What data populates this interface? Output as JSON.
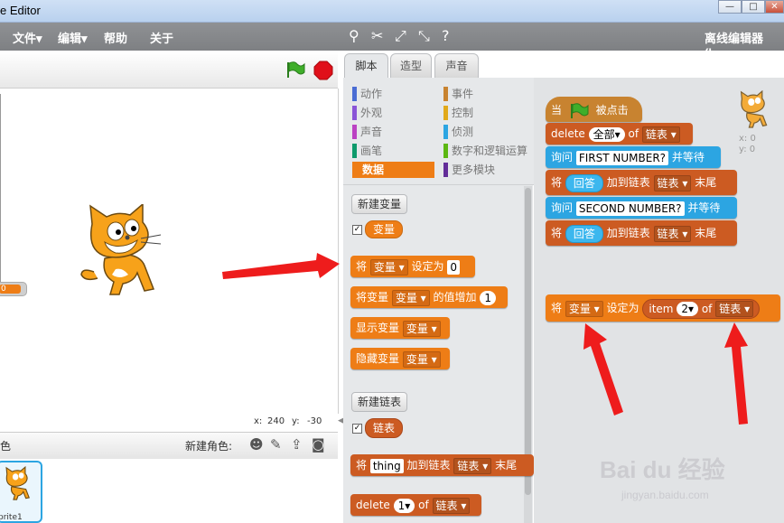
{
  "window": {
    "title": "e Editor",
    "buttons": [
      "—",
      "□",
      "✕"
    ]
  },
  "menubar": {
    "file": "文件",
    "edit": "编辑",
    "help": "帮助",
    "about": "关于",
    "right_label": "离线编辑器 (be"
  },
  "stage": {
    "coords": {
      "x_label": "x:",
      "x_value": "240",
      "y_label": "y:",
      "y_value": "-30"
    },
    "monitor_value": "0",
    "sprites_label": "色",
    "new_sprite_label": "新建角色:",
    "sprite_name": "prite1"
  },
  "tabs": [
    {
      "label": "脚本"
    },
    {
      "label": "造型"
    },
    {
      "label": "声音"
    }
  ],
  "categories": [
    {
      "label": "动作",
      "color": "#4a6cd4"
    },
    {
      "label": "事件",
      "color": "#c88330"
    },
    {
      "label": "外观",
      "color": "#8a55d7"
    },
    {
      "label": "控制",
      "color": "#e1a91a"
    },
    {
      "label": "声音",
      "color": "#bb42c3"
    },
    {
      "label": "侦测",
      "color": "#2ca5e2"
    },
    {
      "label": "画笔",
      "color": "#0e9a6c"
    },
    {
      "label": "数字和逻辑运算",
      "color": "#5cb712"
    },
    {
      "label": "数据",
      "color": "#ee7d16"
    },
    {
      "label": "更多模块",
      "color": "#632d99"
    }
  ],
  "palette": {
    "new_variable": "新建变量",
    "variable_reporter": "变量",
    "set_block": {
      "prefix": "将",
      "var": "变量",
      "middle": "设定为",
      "value": "0"
    },
    "change_block": {
      "prefix": "将变量",
      "var": "变量",
      "middle": "的值增加",
      "value": "1"
    },
    "show_block": {
      "prefix": "显示变量",
      "var": "变量"
    },
    "hide_block": {
      "prefix": "隐藏变量",
      "var": "变量"
    },
    "new_list": "新建链表",
    "list_reporter": "链表",
    "add_block": {
      "prefix": "将",
      "value": "thing",
      "middle": "加到链表",
      "list": "链表",
      "suffix": "末尾"
    },
    "delete_block": {
      "prefix": "delete",
      "value": "1",
      "middle": "of",
      "list": "链表"
    }
  },
  "script": {
    "hat": {
      "prefix": "当",
      "suffix": "被点击"
    },
    "delete_block": {
      "prefix": "delete",
      "value": "全部",
      "middle": "of",
      "list": "链表"
    },
    "ask1": {
      "prefix": "询问",
      "question": "FIRST NUMBER?",
      "suffix": "并等待"
    },
    "add1": {
      "prefix": "将",
      "answer": "回答",
      "middle": "加到链表",
      "list": "链表",
      "suffix": "末尾"
    },
    "ask2": {
      "prefix": "询问",
      "question": "SECOND NUMBER?",
      "suffix": "并等待"
    },
    "add2": {
      "prefix": "将",
      "answer": "回答",
      "middle": "加到链表",
      "list": "链表",
      "suffix": "末尾"
    },
    "set_block": {
      "prefix": "将",
      "var": "变量",
      "middle": "设定为",
      "item_label": "item",
      "item_value": "2",
      "of": "of",
      "list": "链表"
    },
    "sprite_x": "x: 0",
    "sprite_y": "y: 0"
  },
  "watermark": {
    "brand": "Bai du 经验",
    "url": "jingyan.baidu.com"
  },
  "colors": {
    "data_orange": "#ee7d16",
    "list_red": "#cc5b22",
    "sensing_blue": "#2ca5e2",
    "arrow_red": "#ee1c1c"
  }
}
